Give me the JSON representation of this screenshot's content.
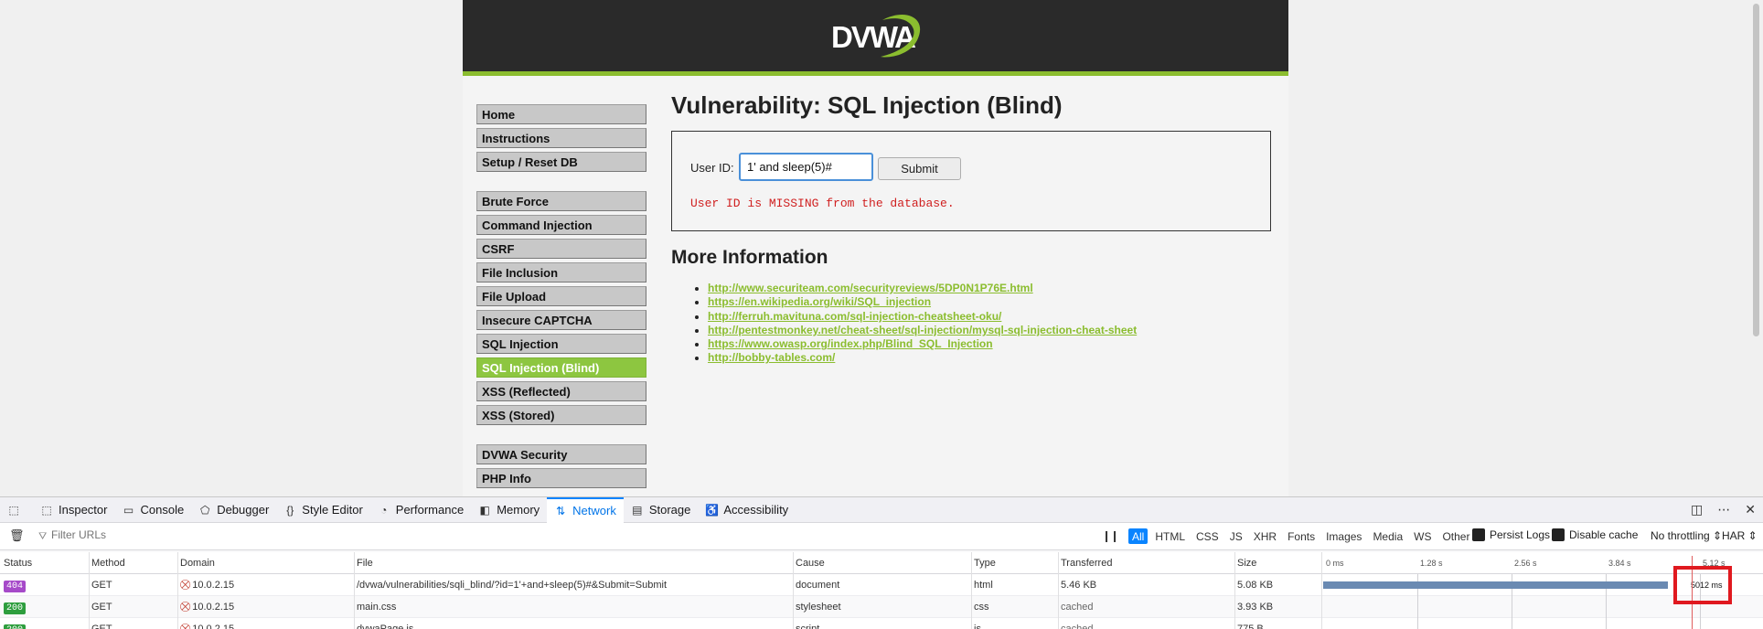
{
  "dvwa": {
    "logo_text": "DVWA",
    "menu_group1": [
      "Home",
      "Instructions",
      "Setup / Reset DB"
    ],
    "menu_group2": [
      "Brute Force",
      "Command Injection",
      "CSRF",
      "File Inclusion",
      "File Upload",
      "Insecure CAPTCHA",
      "SQL Injection",
      "SQL Injection (Blind)",
      "XSS (Reflected)",
      "XSS (Stored)"
    ],
    "menu_group3": [
      "DVWA Security",
      "PHP Info"
    ],
    "selected_item": "SQL Injection (Blind)",
    "title": "Vulnerability: SQL Injection (Blind)",
    "form": {
      "label": "User ID:",
      "value": "1' and sleep(5)#",
      "submit_label": "Submit",
      "message": "User ID is MISSING from the database."
    },
    "more_info_title": "More Information",
    "links": [
      "http://www.securiteam.com/securityreviews/5DP0N1P76E.html",
      "https://en.wikipedia.org/wiki/SQL_injection",
      "http://ferruh.mavituna.com/sql-injection-cheatsheet-oku/",
      "http://pentestmonkey.net/cheat-sheet/sql-injection/mysql-sql-injection-cheat-sheet",
      "https://www.owasp.org/index.php/Blind_SQL_Injection",
      "http://bobby-tables.com/"
    ],
    "colors": {
      "header_bg": "#2a2a2a",
      "accent": "#8bbd2f",
      "error": "#d02020"
    }
  },
  "devtools": {
    "tabs": [
      {
        "label": "Inspector",
        "icon": "inspector-icon"
      },
      {
        "label": "Console",
        "icon": "console-icon"
      },
      {
        "label": "Debugger",
        "icon": "debugger-icon"
      },
      {
        "label": "Style Editor",
        "icon": "style-editor-icon"
      },
      {
        "label": "Performance",
        "icon": "performance-icon"
      },
      {
        "label": "Memory",
        "icon": "memory-icon"
      },
      {
        "label": "Network",
        "icon": "network-icon"
      },
      {
        "label": "Storage",
        "icon": "storage-icon"
      },
      {
        "label": "Accessibility",
        "icon": "accessibility-icon"
      }
    ],
    "active_tab": "Network",
    "filter_placeholder": "Filter URLs",
    "type_filters": [
      "All",
      "HTML",
      "CSS",
      "JS",
      "XHR",
      "Fonts",
      "Images",
      "Media",
      "WS",
      "Other"
    ],
    "active_type_filter": "All",
    "persist_logs": "Persist Logs",
    "disable_cache": "Disable cache",
    "throttling": "No throttling ⇕",
    "har": "HAR ⇕",
    "columns": [
      "Status",
      "Method",
      "Domain",
      "File",
      "Cause",
      "Type",
      "Transferred",
      "Size"
    ],
    "waterfall_ticks": [
      "0 ms",
      "1.28 s",
      "2.56 s",
      "3.84 s",
      "5.12 s"
    ],
    "requests": [
      {
        "status": "404",
        "status_color": "#a64ac9",
        "method": "GET",
        "domain": "10.0.2.15",
        "file": "/dvwa/vulnerabilities/sqli_blind/?id=1'+and+sleep(5)#&Submit=Submit",
        "cause": "document",
        "type": "html",
        "transferred": "5.46 KB",
        "size": "5.08 KB",
        "timing": "5012 ms",
        "duration_ms": 5012
      },
      {
        "status": "200",
        "status_color": "#2e9e3e",
        "method": "GET",
        "domain": "10.0.2.15",
        "file": "main.css",
        "cause": "stylesheet",
        "type": "css",
        "transferred": "cached",
        "size": "3.93 KB"
      },
      {
        "status": "200",
        "status_color": "#2e9e3e",
        "method": "GET",
        "domain": "10.0.2.15",
        "file": "dvwaPage.js",
        "cause": "script",
        "type": "js",
        "transferred": "cached",
        "size": "775 B"
      }
    ]
  }
}
